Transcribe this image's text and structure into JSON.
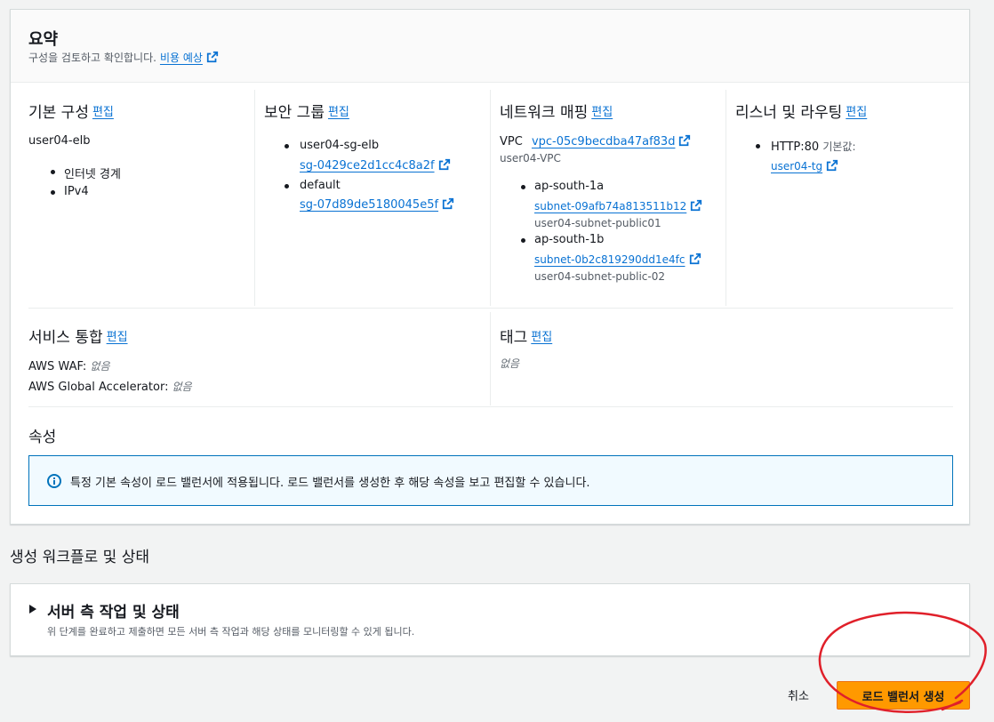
{
  "summary": {
    "title": "요약",
    "description": "구성을 검토하고 확인합니다.",
    "cost_link": "비용 예상"
  },
  "basic": {
    "title": "기본 구성",
    "edit": "편집",
    "name": "user04-elb",
    "items": [
      "인터넷 경계",
      "IPv4"
    ]
  },
  "security": {
    "title": "보안 그룹",
    "edit": "편집",
    "groups": [
      {
        "name": "user04-sg-elb",
        "id": "sg-0429ce2d1cc4c8a2f"
      },
      {
        "name": "default",
        "id": "sg-07d89de5180045e5f"
      }
    ]
  },
  "network": {
    "title": "네트워크 매핑",
    "edit": "편집",
    "vpc_label": "VPC",
    "vpc_id": "vpc-05c9becdba47af83d",
    "vpc_name": "user04-VPC",
    "zones": [
      {
        "zone": "ap-south-1a",
        "subnet_id": "subnet-09afb74a813511b12",
        "subnet_name": "user04-subnet-public01"
      },
      {
        "zone": "ap-south-1b",
        "subnet_id": "subnet-0b2c819290dd1e4fc",
        "subnet_name": "user04-subnet-public-02"
      }
    ]
  },
  "listener": {
    "title": "리스너 및 라우팅",
    "edit": "편집",
    "protocol": "HTTP:80",
    "default_label": "기본값:",
    "target_group": "user04-tg"
  },
  "integration": {
    "title": "서비스 통합",
    "edit": "편집",
    "waf_label": "AWS WAF:",
    "waf_value": "없음",
    "ga_label": "AWS Global Accelerator:",
    "ga_value": "없음"
  },
  "tags": {
    "title": "태그",
    "edit": "편집",
    "value": "없음"
  },
  "attributes": {
    "title": "속성",
    "info": "특정 기본 속성이 로드 밸런서에 적용됩니다. 로드 밸런서를 생성한 후 해당 속성을 보고 편집할 수 있습니다."
  },
  "workflow": {
    "title": "생성 워크플로 및 상태",
    "panel_title": "서버 측 작업 및 상태",
    "panel_desc": "위 단계를 완료하고 제출하면 모든 서버 측 작업과 해당 상태를 모니터링할 수 있게 됩니다."
  },
  "actions": {
    "cancel": "취소",
    "create": "로드 밸런서 생성"
  },
  "colors": {
    "link": "#0972d3",
    "primary_button": "#ff9900",
    "info_border": "#0073bb",
    "annotation": "#e0202a"
  }
}
